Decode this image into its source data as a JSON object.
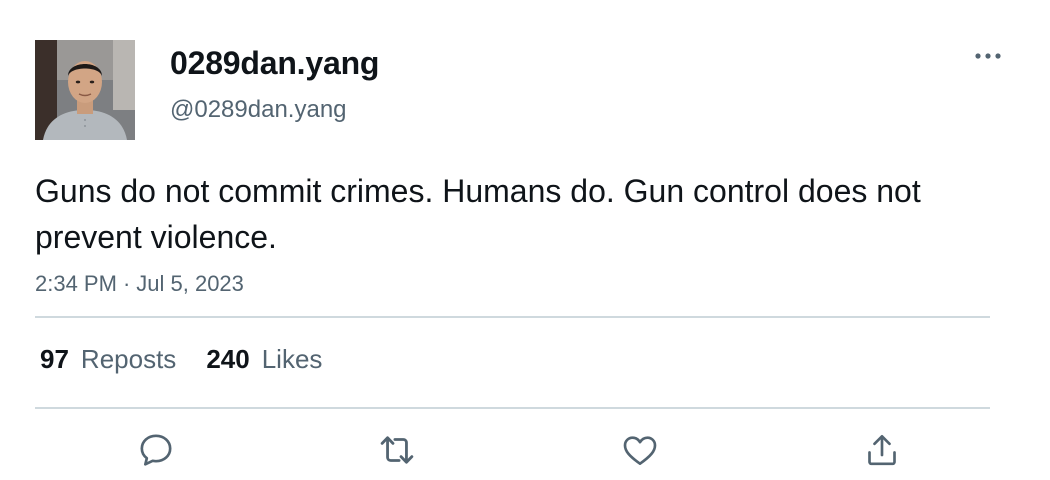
{
  "author": {
    "display_name": "0289dan.yang",
    "handle": "@0289dan.yang"
  },
  "tweet": {
    "text": "Guns do not commit crimes. Humans do. Gun control does not prevent violence.",
    "time": "2:34 PM",
    "separator": "·",
    "date": "Jul 5, 2023"
  },
  "stats": {
    "reposts_count": "97",
    "reposts_label": "Reposts",
    "likes_count": "240",
    "likes_label": "Likes"
  },
  "actions": {
    "reply_icon": "speech-bubble-icon",
    "repost_icon": "repost-arrows-icon",
    "like_icon": "heart-icon",
    "share_icon": "share-upload-icon"
  },
  "colors": {
    "text_primary": "#0f1419",
    "text_secondary": "#536471",
    "divider": "#cfd9de",
    "icon": "#536471"
  }
}
